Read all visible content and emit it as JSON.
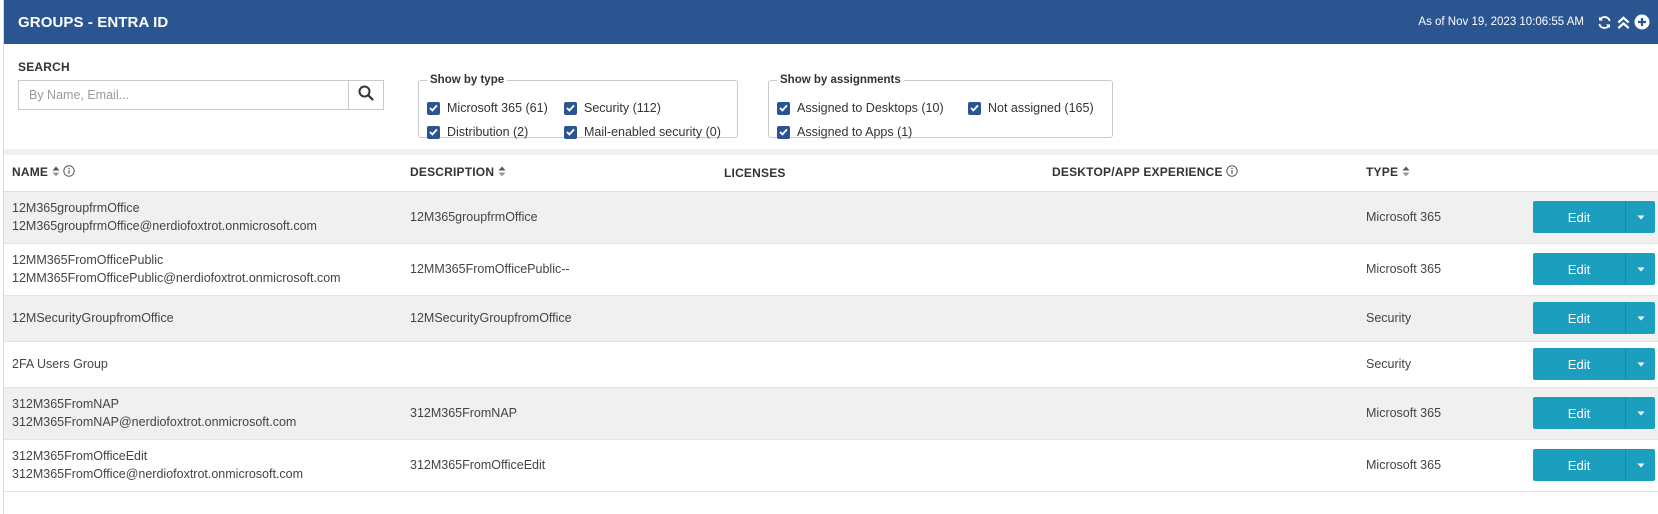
{
  "header": {
    "title": "GROUPS - ENTRA ID",
    "as_of": "As of Nov 19, 2023 10:06:55 AM",
    "icons": [
      "refresh-icon",
      "collapse-icon",
      "add-icon"
    ],
    "bg_color": "#2b5591"
  },
  "search": {
    "label": "SEARCH",
    "placeholder": "By Name, Email...",
    "value": ""
  },
  "show_by_type": {
    "legend": "Show by type",
    "options": [
      {
        "label": "Microsoft 365 (61)",
        "checked": true
      },
      {
        "label": "Security (112)",
        "checked": true
      },
      {
        "label": "Distribution (2)",
        "checked": true
      },
      {
        "label": "Mail-enabled security (0)",
        "checked": true
      }
    ]
  },
  "show_by_assignments": {
    "legend": "Show by assignments",
    "options": [
      {
        "label": "Assigned to Desktops (10)",
        "checked": true
      },
      {
        "label": "Not assigned (165)",
        "checked": true
      },
      {
        "label": "Assigned to Apps (1)",
        "checked": true
      }
    ]
  },
  "columns": {
    "name": "NAME",
    "description": "DESCRIPTION",
    "licenses": "LICENSES",
    "experience": "DESKTOP/APP EXPERIENCE",
    "type": "TYPE"
  },
  "rows": [
    {
      "name": "12M365groupfrmOffice",
      "email": "12M365groupfrmOffice@nerdiofoxtrot.onmicrosoft.com",
      "description": "12M365groupfrmOffice",
      "licenses": "",
      "experience": "",
      "type": "Microsoft 365",
      "edit": "Edit"
    },
    {
      "name": "12MM365FromOfficePublic",
      "email": "12MM365FromOfficePublic@nerdiofoxtrot.onmicrosoft.com",
      "description": "12MM365FromOfficePublic--",
      "licenses": "",
      "experience": "",
      "type": "Microsoft 365",
      "edit": "Edit"
    },
    {
      "name": "12MSecurityGroupfromOffice",
      "email": "",
      "description": "12MSecurityGroupfromOffice",
      "licenses": "",
      "experience": "",
      "type": "Security",
      "edit": "Edit"
    },
    {
      "name": "2FA Users Group",
      "email": "",
      "description": "",
      "licenses": "",
      "experience": "",
      "type": "Security",
      "edit": "Edit"
    },
    {
      "name": "312M365FromNAP",
      "email": "312M365FromNAP@nerdiofoxtrot.onmicrosoft.com",
      "description": "312M365FromNAP",
      "licenses": "",
      "experience": "",
      "type": "Microsoft 365",
      "edit": "Edit"
    },
    {
      "name": "312M365FromOfficeEdit",
      "email": "312M365FromOffice@nerdiofoxtrot.onmicrosoft.com",
      "description": "312M365FromOfficeEdit",
      "licenses": "",
      "experience": "",
      "type": "Microsoft 365",
      "edit": "Edit"
    }
  ],
  "colors": {
    "accent_button": "#1c9ebf",
    "checkbox": "#2b5591",
    "alt_row": "#f0f0f0"
  }
}
